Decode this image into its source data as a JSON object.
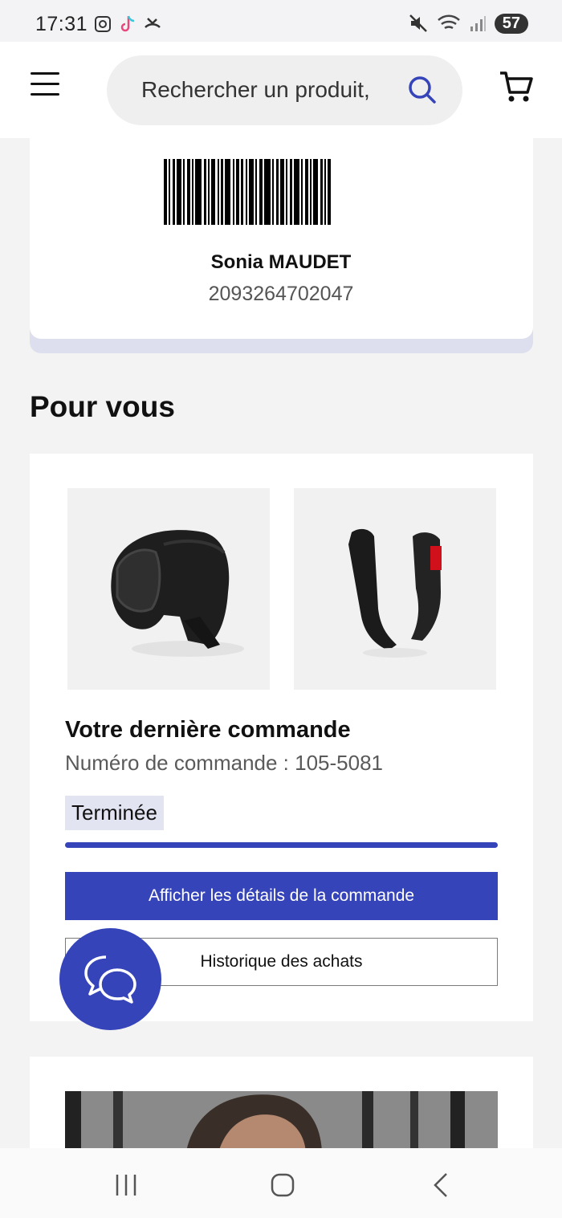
{
  "status_bar": {
    "time": "17:31",
    "battery": "57"
  },
  "header": {
    "search_placeholder": "Rechercher un produit,"
  },
  "loyalty_card": {
    "name": "Sonia MAUDET",
    "number": "2093264702047"
  },
  "section": {
    "title": "Pour vous"
  },
  "order": {
    "title": "Votre dernière commande",
    "number_line": "Numéro de commande : 105-5081",
    "status": "Terminée",
    "progress": 1.0,
    "details_button": "Afficher les détails de la commande",
    "history_button": "Historique des achats",
    "products": [
      "boxing-headgear",
      "shin-guards"
    ]
  },
  "colors": {
    "accent": "#3644ba",
    "badge_bg": "#e3e4f2",
    "page_bg": "#f3f3f3"
  },
  "icons": {
    "menu": "menu-icon",
    "search": "search-icon",
    "cart": "cart-icon",
    "chat": "chat-icon",
    "nav_recents": "recents-icon",
    "nav_home": "home-icon",
    "nav_back": "back-icon"
  }
}
